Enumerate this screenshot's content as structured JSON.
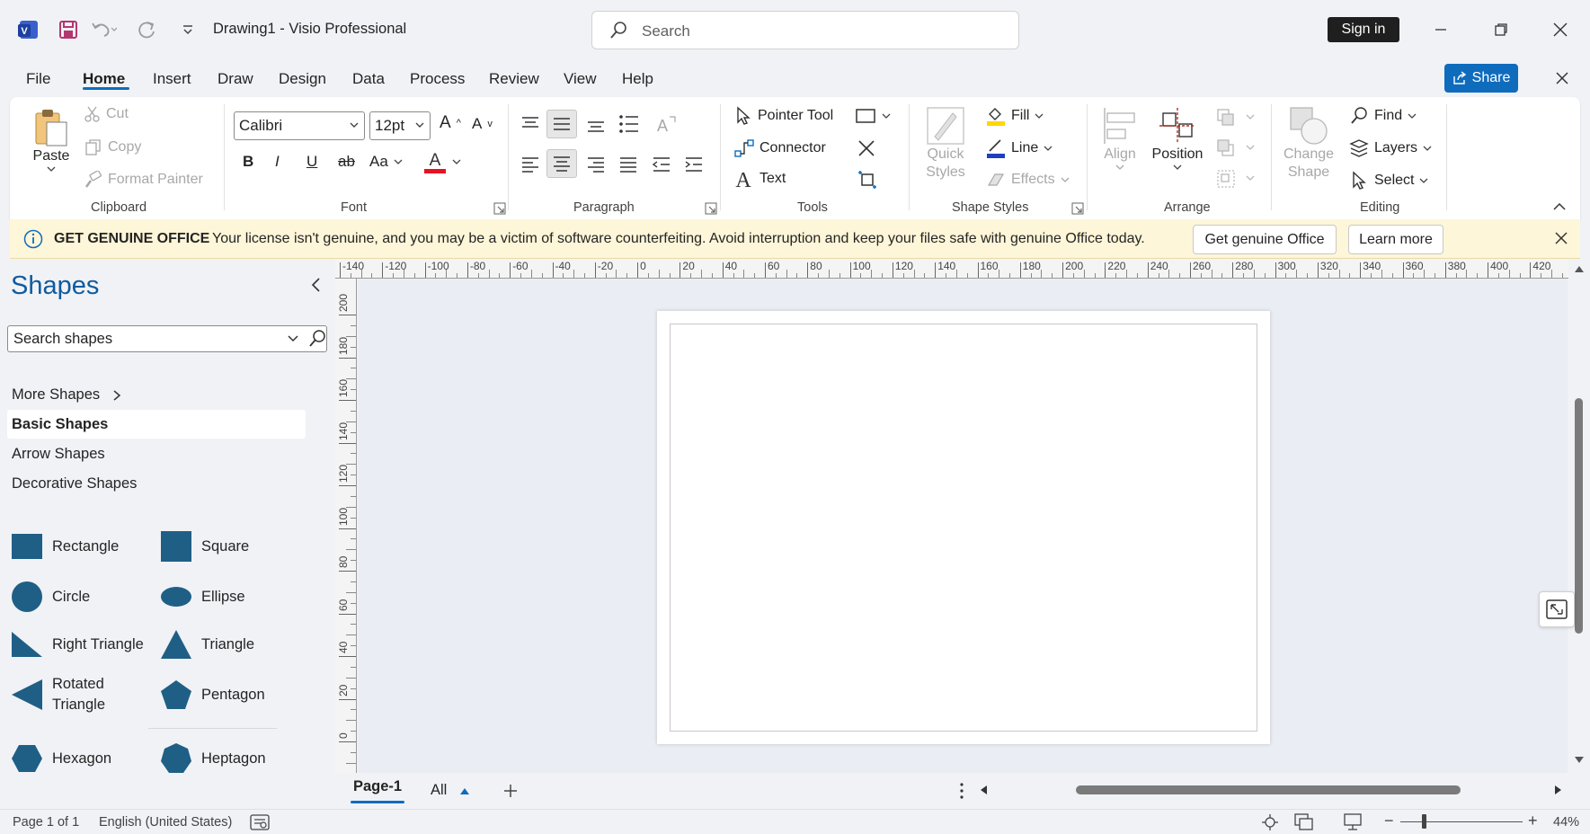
{
  "titlebar": {
    "doc_title": "Drawing1  -  Visio Professional",
    "search_placeholder": "Search",
    "sign_in": "Sign in",
    "icons": [
      "visio-app-icon",
      "save-icon",
      "undo-icon",
      "redo-icon",
      "customize-toolbar-icon",
      "minimize-icon",
      "restore-icon",
      "close-icon"
    ]
  },
  "menu": {
    "tabs": [
      {
        "label": "File"
      },
      {
        "label": "Home",
        "active": true
      },
      {
        "label": "Insert"
      },
      {
        "label": "Draw"
      },
      {
        "label": "Design"
      },
      {
        "label": "Data"
      },
      {
        "label": "Process"
      },
      {
        "label": "Review"
      },
      {
        "label": "View"
      },
      {
        "label": "Help"
      }
    ],
    "share": "Share"
  },
  "ribbon": {
    "clipboard": {
      "label": "Clipboard",
      "paste": "Paste",
      "cut": "Cut",
      "copy": "Copy",
      "format_painter": "Format Painter"
    },
    "font": {
      "label": "Font",
      "font_name": "Calibri",
      "font_size": "12pt",
      "change_case": "Aa"
    },
    "paragraph": {
      "label": "Paragraph"
    },
    "tools": {
      "label": "Tools",
      "pointer": "Pointer Tool",
      "connector": "Connector",
      "text": "Text"
    },
    "shape_styles": {
      "label": "Shape Styles",
      "quick_styles_1": "Quick",
      "quick_styles_2": "Styles",
      "fill": "Fill",
      "line": "Line",
      "effects": "Effects"
    },
    "arrange": {
      "label": "Arrange",
      "align": "Align",
      "position": "Position"
    },
    "change_shape": {
      "line1": "Change",
      "line2": "Shape"
    },
    "editing": {
      "label": "Editing",
      "find": "Find",
      "layers": "Layers",
      "select": "Select"
    }
  },
  "infobar": {
    "title": "GET GENUINE OFFICE",
    "message": "Your license isn't genuine, and you may be a victim of software counterfeiting. Avoid interruption and keep your files safe with genuine Office today.",
    "get_genuine": "Get genuine Office",
    "learn_more": "Learn more"
  },
  "shapes_pane": {
    "title": "Shapes",
    "search_placeholder": "Search shapes",
    "more_shapes": "More Shapes",
    "categories": [
      "Basic Shapes",
      "Arrow Shapes",
      "Decorative Shapes"
    ],
    "selected_category": "Basic Shapes",
    "shapes": [
      {
        "name": "Rectangle",
        "icon": "rectangle-icon"
      },
      {
        "name": "Square",
        "icon": "square-icon"
      },
      {
        "name": "Circle",
        "icon": "circle-icon"
      },
      {
        "name": "Ellipse",
        "icon": "ellipse-icon"
      },
      {
        "name": "Right Triangle",
        "icon": "right-triangle-icon"
      },
      {
        "name": "Triangle",
        "icon": "triangle-icon"
      },
      {
        "name": "Rotated Triangle",
        "icon": "rotated-triangle-icon"
      },
      {
        "name": "Pentagon",
        "icon": "pentagon-icon"
      },
      {
        "name": "Hexagon",
        "icon": "hexagon-icon"
      },
      {
        "name": "Heptagon",
        "icon": "heptagon-icon"
      }
    ],
    "shape_color": "#1f5f86"
  },
  "rulers": {
    "top": [
      "-140",
      "-120",
      "-100",
      "-80",
      "-60",
      "-40",
      "-20",
      "0",
      "20",
      "40",
      "60",
      "80",
      "100",
      "120",
      "140",
      "160",
      "180",
      "200",
      "220",
      "240",
      "260",
      "280",
      "300",
      "320",
      "340",
      "360",
      "380",
      "400",
      "420"
    ],
    "left": [
      "200",
      "180",
      "160",
      "140",
      "120",
      "100",
      "80",
      "60",
      "40",
      "20",
      "0"
    ]
  },
  "pages": {
    "current": "Page-1",
    "all": "All"
  },
  "status": {
    "page_info": "Page 1 of 1",
    "language": "English (United States)",
    "zoom": "44%"
  },
  "colors": {
    "accent": "#0f6cbd",
    "info_bg": "#fdf6d8",
    "font_color_bar": "#e81123",
    "fill_bar": "#ffd700",
    "line_bar": "#1f3fbf"
  }
}
